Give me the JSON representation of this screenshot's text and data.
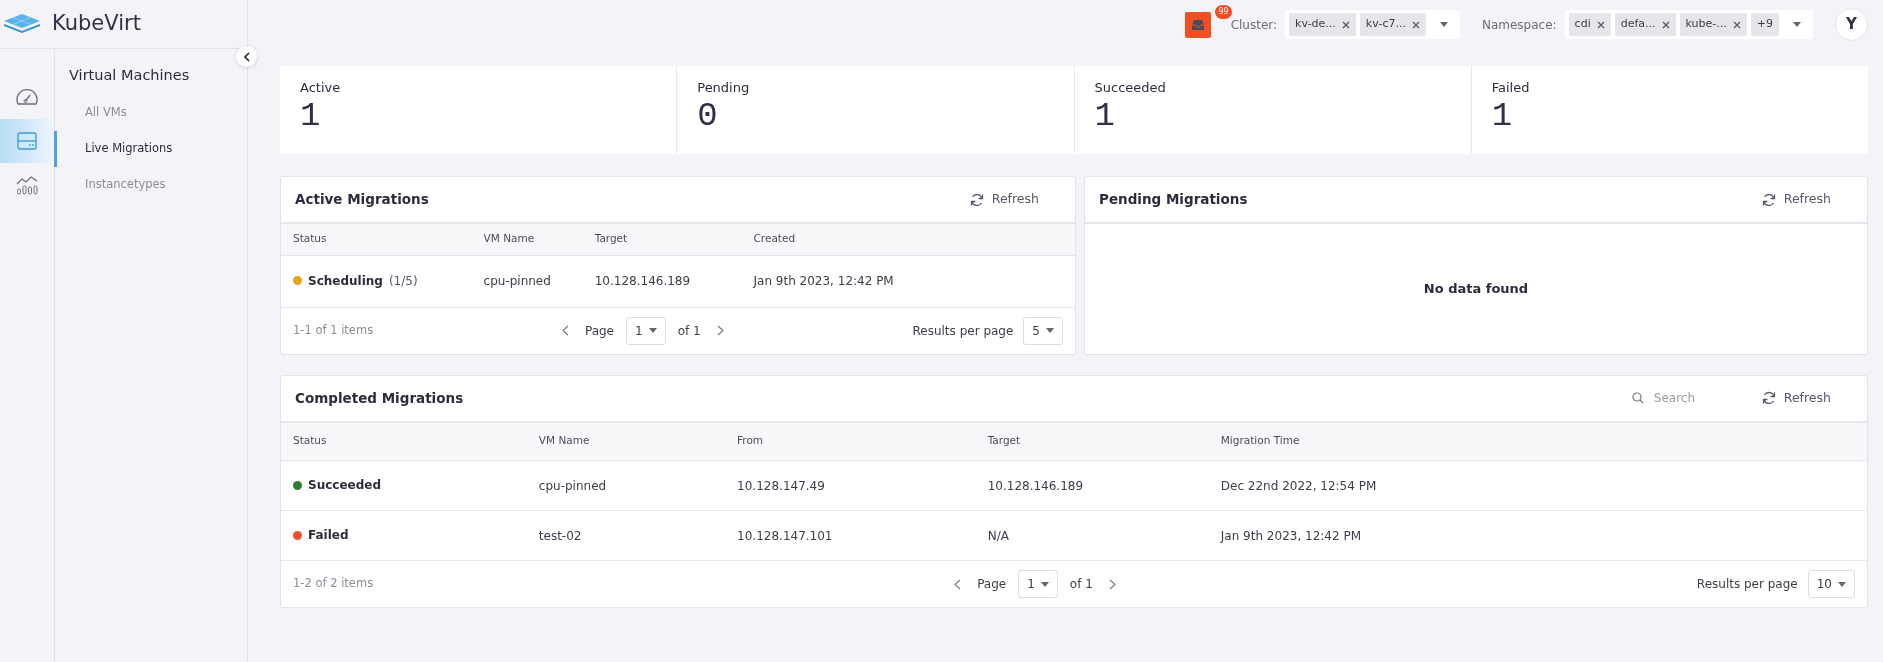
{
  "brand": {
    "name": "KubeVirt"
  },
  "rail": [
    {
      "selected": false
    },
    {
      "selected": true
    },
    {
      "selected": false
    }
  ],
  "nav": {
    "title": "Virtual Machines",
    "items": [
      {
        "label": "All VMs",
        "selected": false
      },
      {
        "label": "Live Migrations",
        "selected": true
      },
      {
        "label": "Instancetypes",
        "selected": false
      }
    ]
  },
  "topbar": {
    "notifications": "99",
    "cluster": {
      "label": "Cluster:",
      "chips": [
        "kv-de...",
        "kv-c7..."
      ]
    },
    "namespace": {
      "label": "Namespace:",
      "chips": [
        "cdi",
        "defa...",
        "kube-..."
      ],
      "more": "+9"
    },
    "avatar": "Y"
  },
  "stats": [
    {
      "label": "Active",
      "value": "1"
    },
    {
      "label": "Pending",
      "value": "0"
    },
    {
      "label": "Succeeded",
      "value": "1"
    },
    {
      "label": "Failed",
      "value": "1"
    }
  ],
  "active_migrations": {
    "title": "Active Migrations",
    "refresh": "Refresh",
    "columns": [
      "Status",
      "VM Name",
      "Target",
      "Created"
    ],
    "rows": [
      {
        "cells": [
          {
            "status": "Scheduling",
            "note": "(1/5)",
            "color": "#e8a317"
          },
          "cpu-pinned",
          "10.128.146.189",
          "Jan 9th 2023, 12:42 PM"
        ]
      }
    ],
    "footer": {
      "range": "1-1 of 1 items",
      "page_label": "Page",
      "page": "1",
      "of": "of 1",
      "per_page_label": "Results per page",
      "per_page": "5"
    }
  },
  "pending_migrations": {
    "title": "Pending Migrations",
    "refresh": "Refresh",
    "empty": "No data found"
  },
  "completed_migrations": {
    "title": "Completed Migrations",
    "search": {
      "placeholder": "Search"
    },
    "refresh": "Refresh",
    "columns": [
      "Status",
      "VM Name",
      "From",
      "Target",
      "Migration Time"
    ],
    "rows": [
      {
        "cells": [
          {
            "status": "Succeeded",
            "color": "#2e7d32"
          },
          "cpu-pinned",
          "10.128.147.49",
          "10.128.146.189",
          "Dec 22nd 2022, 12:54 PM"
        ]
      },
      {
        "cells": [
          {
            "status": "Failed",
            "color": "#f0502a"
          },
          "test-02",
          "10.128.147.101",
          "N/A",
          "Jan 9th 2023, 12:42 PM"
        ]
      }
    ],
    "footer": {
      "range": "1-2 of 2 items",
      "page_label": "Page",
      "page": "1",
      "of": "of 1",
      "per_page_label": "Results per page",
      "per_page": "10"
    }
  }
}
